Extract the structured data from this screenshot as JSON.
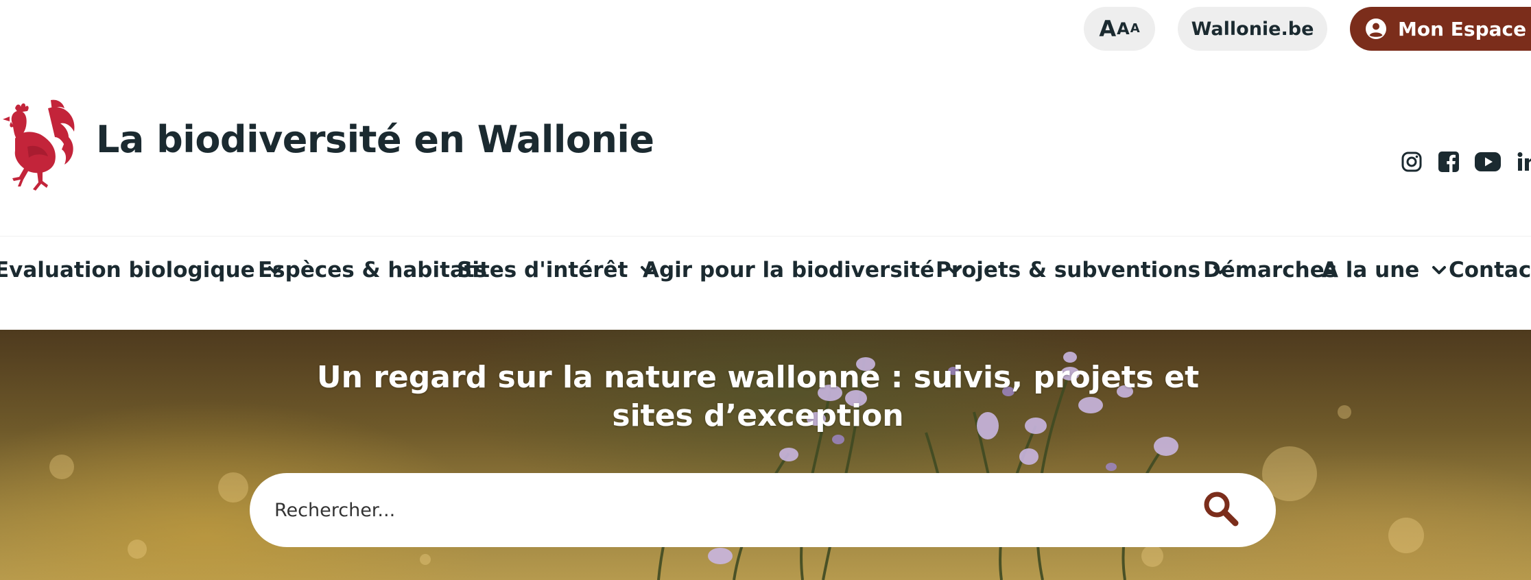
{
  "top_bar": {
    "font_size_parts": [
      "A",
      "A",
      "A"
    ],
    "wallonie_link": "Wallonie.be",
    "mon_espace": "Mon Espace",
    "mon_espace_color": "#7b2d1b"
  },
  "header": {
    "site_title": "La biodiversité en Wallonie",
    "logo_color": "#c3243a",
    "socials": [
      "instagram-icon",
      "facebook-icon",
      "youtube-icon",
      "linkedin-icon"
    ]
  },
  "nav": {
    "items": [
      {
        "label": "Evaluation biologique",
        "has_dropdown": true
      },
      {
        "label": "Espèces & habitats",
        "has_dropdown": false
      },
      {
        "label": "Sites d'intérêt",
        "has_dropdown": true
      },
      {
        "label": "Agir pour la biodiversité",
        "has_dropdown": true
      },
      {
        "label": "Projets & subventions",
        "has_dropdown": true
      },
      {
        "label": "Démarches",
        "has_dropdown": false
      },
      {
        "label": "A la une",
        "has_dropdown": true
      },
      {
        "label": "Contact",
        "has_dropdown": false
      }
    ]
  },
  "hero": {
    "title": "Un regard sur la nature wallonne : suivis, projets et sites d’exception"
  },
  "search": {
    "placeholder": "Rechercher...",
    "icon": "search-icon",
    "icon_color": "#7b2d1b"
  }
}
